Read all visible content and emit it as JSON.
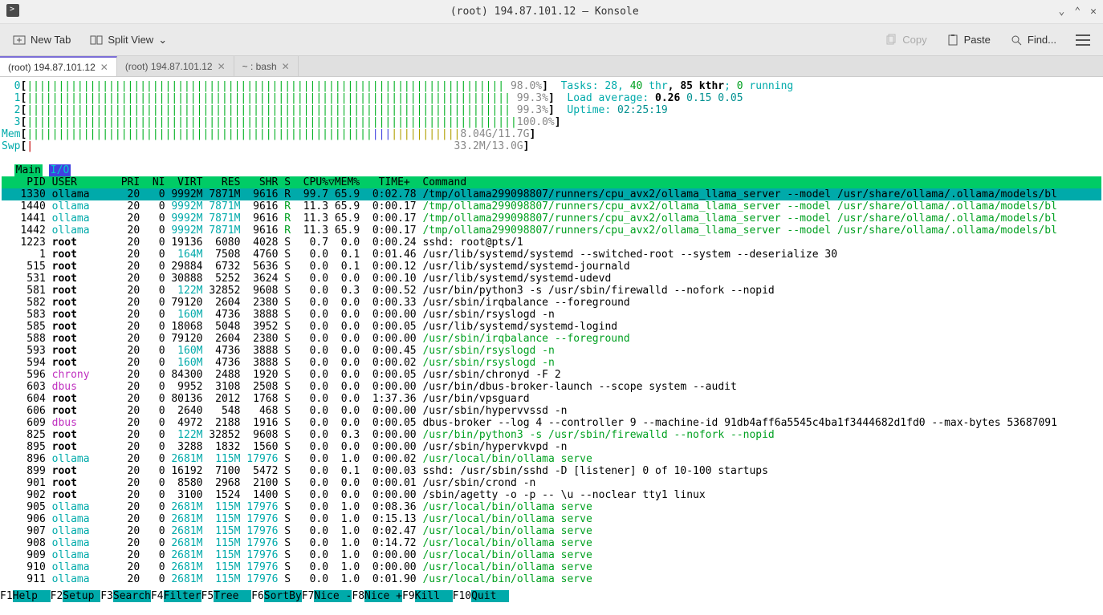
{
  "window": {
    "title": "(root) 194.87.101.12 — Konsole"
  },
  "toolbar": {
    "newtab": "New Tab",
    "splitview": "Split View",
    "copy": "Copy",
    "paste": "Paste",
    "find": "Find..."
  },
  "tabs": [
    {
      "label": "(root) 194.87.101.12",
      "active": true
    },
    {
      "label": "(root) 194.87.101.12",
      "active": false
    },
    {
      "label": "~ : bash",
      "active": false
    }
  ],
  "meters": {
    "cpu": [
      {
        "id": "0",
        "pct": "98.0%"
      },
      {
        "id": "1",
        "pct": "99.3%"
      },
      {
        "id": "2",
        "pct": "99.3%"
      },
      {
        "id": "3",
        "pct": "100.0%"
      }
    ],
    "mem_label": "Mem",
    "mem_val": "8.04G/11.7G",
    "swp_label": "Swp",
    "swp_val": "33.2M/13.0G",
    "tasks_label": "Tasks: ",
    "tasks_count": "28",
    "thr_count": "40",
    "thr_label": " thr",
    "kthr": "85 kthr",
    "running_count": "0",
    "running_label": " running",
    "load_label": "Load average: ",
    "load1": "0.26",
    "load2": "0.15",
    "load3": "0.05",
    "uptime_label": "Uptime: ",
    "uptime_val": "02:25:19"
  },
  "htop_tabs": {
    "main": "Main",
    "io": "I/O"
  },
  "columns": "    PID USER       PRI  NI  VIRT   RES   SHR S  CPU%▽MEM%   TIME+  Command",
  "chart_data": {
    "type": "table",
    "title": "htop process list",
    "columns": [
      "PID",
      "USER",
      "PRI",
      "NI",
      "VIRT",
      "RES",
      "SHR",
      "S",
      "CPU%",
      "MEM%",
      "TIME+",
      "Command"
    ],
    "rows": [
      [
        1330,
        "ollama",
        20,
        0,
        "9992M",
        "7871M",
        9616,
        "R",
        99.7,
        65.9,
        "0:02.78",
        "/tmp/ollama299098807/runners/cpu_avx2/ollama_llama_server --model /usr/share/ollama/.ollama/models/bl"
      ],
      [
        1440,
        "ollama",
        20,
        0,
        "9992M",
        "7871M",
        9616,
        "R",
        11.3,
        65.9,
        "0:00.17",
        "/tmp/ollama299098807/runners/cpu_avx2/ollama_llama_server --model /usr/share/ollama/.ollama/models/bl"
      ],
      [
        1441,
        "ollama",
        20,
        0,
        "9992M",
        "7871M",
        9616,
        "R",
        11.3,
        65.9,
        "0:00.17",
        "/tmp/ollama299098807/runners/cpu_avx2/ollama_llama_server --model /usr/share/ollama/.ollama/models/bl"
      ],
      [
        1442,
        "ollama",
        20,
        0,
        "9992M",
        "7871M",
        9616,
        "R",
        11.3,
        65.9,
        "0:00.17",
        "/tmp/ollama299098807/runners/cpu_avx2/ollama_llama_server --model /usr/share/ollama/.ollama/models/bl"
      ],
      [
        1223,
        "root",
        20,
        0,
        "19136",
        "6080",
        4028,
        "S",
        0.7,
        0.0,
        "0:00.24",
        "sshd: root@pts/1"
      ],
      [
        1,
        "root",
        20,
        0,
        "164M",
        "7508",
        4760,
        "S",
        0.0,
        0.1,
        "0:01.46",
        "/usr/lib/systemd/systemd --switched-root --system --deserialize 30"
      ],
      [
        515,
        "root",
        20,
        0,
        "29884",
        "6732",
        5636,
        "S",
        0.0,
        0.1,
        "0:00.12",
        "/usr/lib/systemd/systemd-journald"
      ],
      [
        531,
        "root",
        20,
        0,
        "30888",
        "5252",
        3624,
        "S",
        0.0,
        0.0,
        "0:00.10",
        "/usr/lib/systemd/systemd-udevd"
      ],
      [
        581,
        "root",
        20,
        0,
        "122M",
        "32852",
        9608,
        "S",
        0.0,
        0.3,
        "0:00.52",
        "/usr/bin/python3 -s /usr/sbin/firewalld --nofork --nopid"
      ],
      [
        582,
        "root",
        20,
        0,
        "79120",
        "2604",
        2380,
        "S",
        0.0,
        0.0,
        "0:00.33",
        "/usr/sbin/irqbalance --foreground"
      ],
      [
        583,
        "root",
        20,
        0,
        "160M",
        "4736",
        3888,
        "S",
        0.0,
        0.0,
        "0:00.00",
        "/usr/sbin/rsyslogd -n"
      ],
      [
        585,
        "root",
        20,
        0,
        "18068",
        "5048",
        3952,
        "S",
        0.0,
        0.0,
        "0:00.05",
        "/usr/lib/systemd/systemd-logind"
      ],
      [
        588,
        "root",
        20,
        0,
        "79120",
        "2604",
        2380,
        "S",
        0.0,
        0.0,
        "0:00.00",
        "/usr/sbin/irqbalance --foreground"
      ],
      [
        593,
        "root",
        20,
        0,
        "160M",
        "4736",
        3888,
        "S",
        0.0,
        0.0,
        "0:00.45",
        "/usr/sbin/rsyslogd -n"
      ],
      [
        594,
        "root",
        20,
        0,
        "160M",
        "4736",
        3888,
        "S",
        0.0,
        0.0,
        "0:00.02",
        "/usr/sbin/rsyslogd -n"
      ],
      [
        596,
        "chrony",
        20,
        0,
        "84300",
        "2488",
        1920,
        "S",
        0.0,
        0.0,
        "0:00.05",
        "/usr/sbin/chronyd -F 2"
      ],
      [
        603,
        "dbus",
        20,
        0,
        "9952",
        "3108",
        2508,
        "S",
        0.0,
        0.0,
        "0:00.00",
        "/usr/bin/dbus-broker-launch --scope system --audit"
      ],
      [
        604,
        "root",
        20,
        0,
        "80136",
        "2012",
        1768,
        "S",
        0.0,
        0.0,
        "1:37.36",
        "/usr/bin/vpsguard"
      ],
      [
        606,
        "root",
        20,
        0,
        "2640",
        "548",
        468,
        "S",
        0.0,
        0.0,
        "0:00.00",
        "/usr/sbin/hypervvssd -n"
      ],
      [
        609,
        "dbus",
        20,
        0,
        "4972",
        "2188",
        1916,
        "S",
        0.0,
        0.0,
        "0:00.05",
        "dbus-broker --log 4 --controller 9 --machine-id 91db4aff6a5545c4ba1f3444682d1fd0 --max-bytes 53687091"
      ],
      [
        825,
        "root",
        20,
        0,
        "122M",
        "32852",
        9608,
        "S",
        0.0,
        0.3,
        "0:00.00",
        "/usr/bin/python3 -s /usr/sbin/firewalld --nofork --nopid"
      ],
      [
        895,
        "root",
        20,
        0,
        "3288",
        "1832",
        1560,
        "S",
        0.0,
        0.0,
        "0:00.00",
        "/usr/sbin/hypervkvpd -n"
      ],
      [
        896,
        "ollama",
        20,
        0,
        "2681M",
        "115M",
        17976,
        "S",
        0.0,
        1.0,
        "0:00.02",
        "/usr/local/bin/ollama serve"
      ],
      [
        899,
        "root",
        20,
        0,
        "16192",
        "7100",
        5472,
        "S",
        0.0,
        0.1,
        "0:00.03",
        "sshd: /usr/sbin/sshd -D [listener] 0 of 10-100 startups"
      ],
      [
        901,
        "root",
        20,
        0,
        "8580",
        "2968",
        2100,
        "S",
        0.0,
        0.0,
        "0:00.01",
        "/usr/sbin/crond -n"
      ],
      [
        902,
        "root",
        20,
        0,
        "3100",
        "1524",
        1400,
        "S",
        0.0,
        0.0,
        "0:00.00",
        "/sbin/agetty -o -p -- \\u --noclear tty1 linux"
      ],
      [
        905,
        "ollama",
        20,
        0,
        "2681M",
        "115M",
        17976,
        "S",
        0.0,
        1.0,
        "0:08.36",
        "/usr/local/bin/ollama serve"
      ],
      [
        906,
        "ollama",
        20,
        0,
        "2681M",
        "115M",
        17976,
        "S",
        0.0,
        1.0,
        "0:15.13",
        "/usr/local/bin/ollama serve"
      ],
      [
        907,
        "ollama",
        20,
        0,
        "2681M",
        "115M",
        17976,
        "S",
        0.0,
        1.0,
        "0:02.47",
        "/usr/local/bin/ollama serve"
      ],
      [
        908,
        "ollama",
        20,
        0,
        "2681M",
        "115M",
        17976,
        "S",
        0.0,
        1.0,
        "0:14.72",
        "/usr/local/bin/ollama serve"
      ],
      [
        909,
        "ollama",
        20,
        0,
        "2681M",
        "115M",
        17976,
        "S",
        0.0,
        1.0,
        "0:00.00",
        "/usr/local/bin/ollama serve"
      ],
      [
        910,
        "ollama",
        20,
        0,
        "2681M",
        "115M",
        17976,
        "S",
        0.0,
        1.0,
        "0:00.00",
        "/usr/local/bin/ollama serve"
      ],
      [
        911,
        "ollama",
        20,
        0,
        "2681M",
        "115M",
        17976,
        "S",
        0.0,
        1.0,
        "0:01.90",
        "/usr/local/bin/ollama serve"
      ]
    ],
    "green_cmd_rows": [
      0,
      1,
      2,
      3,
      12,
      13,
      14,
      20,
      22,
      26,
      27,
      28,
      29,
      30,
      31,
      32
    ],
    "selected_row": 0,
    "user_colors": {
      "ollama": "cyan",
      "root": "black",
      "chrony": "magenta",
      "dbus": "magenta"
    }
  },
  "fkeys": [
    {
      "k": "F1",
      "l": "Help  "
    },
    {
      "k": "F2",
      "l": "Setup "
    },
    {
      "k": "F3",
      "l": "Search"
    },
    {
      "k": "F4",
      "l": "Filter"
    },
    {
      "k": "F5",
      "l": "Tree  "
    },
    {
      "k": "F6",
      "l": "SortBy"
    },
    {
      "k": "F7",
      "l": "Nice -"
    },
    {
      "k": "F8",
      "l": "Nice +"
    },
    {
      "k": "F9",
      "l": "Kill  "
    },
    {
      "k": "F10",
      "l": "Quit  "
    }
  ]
}
